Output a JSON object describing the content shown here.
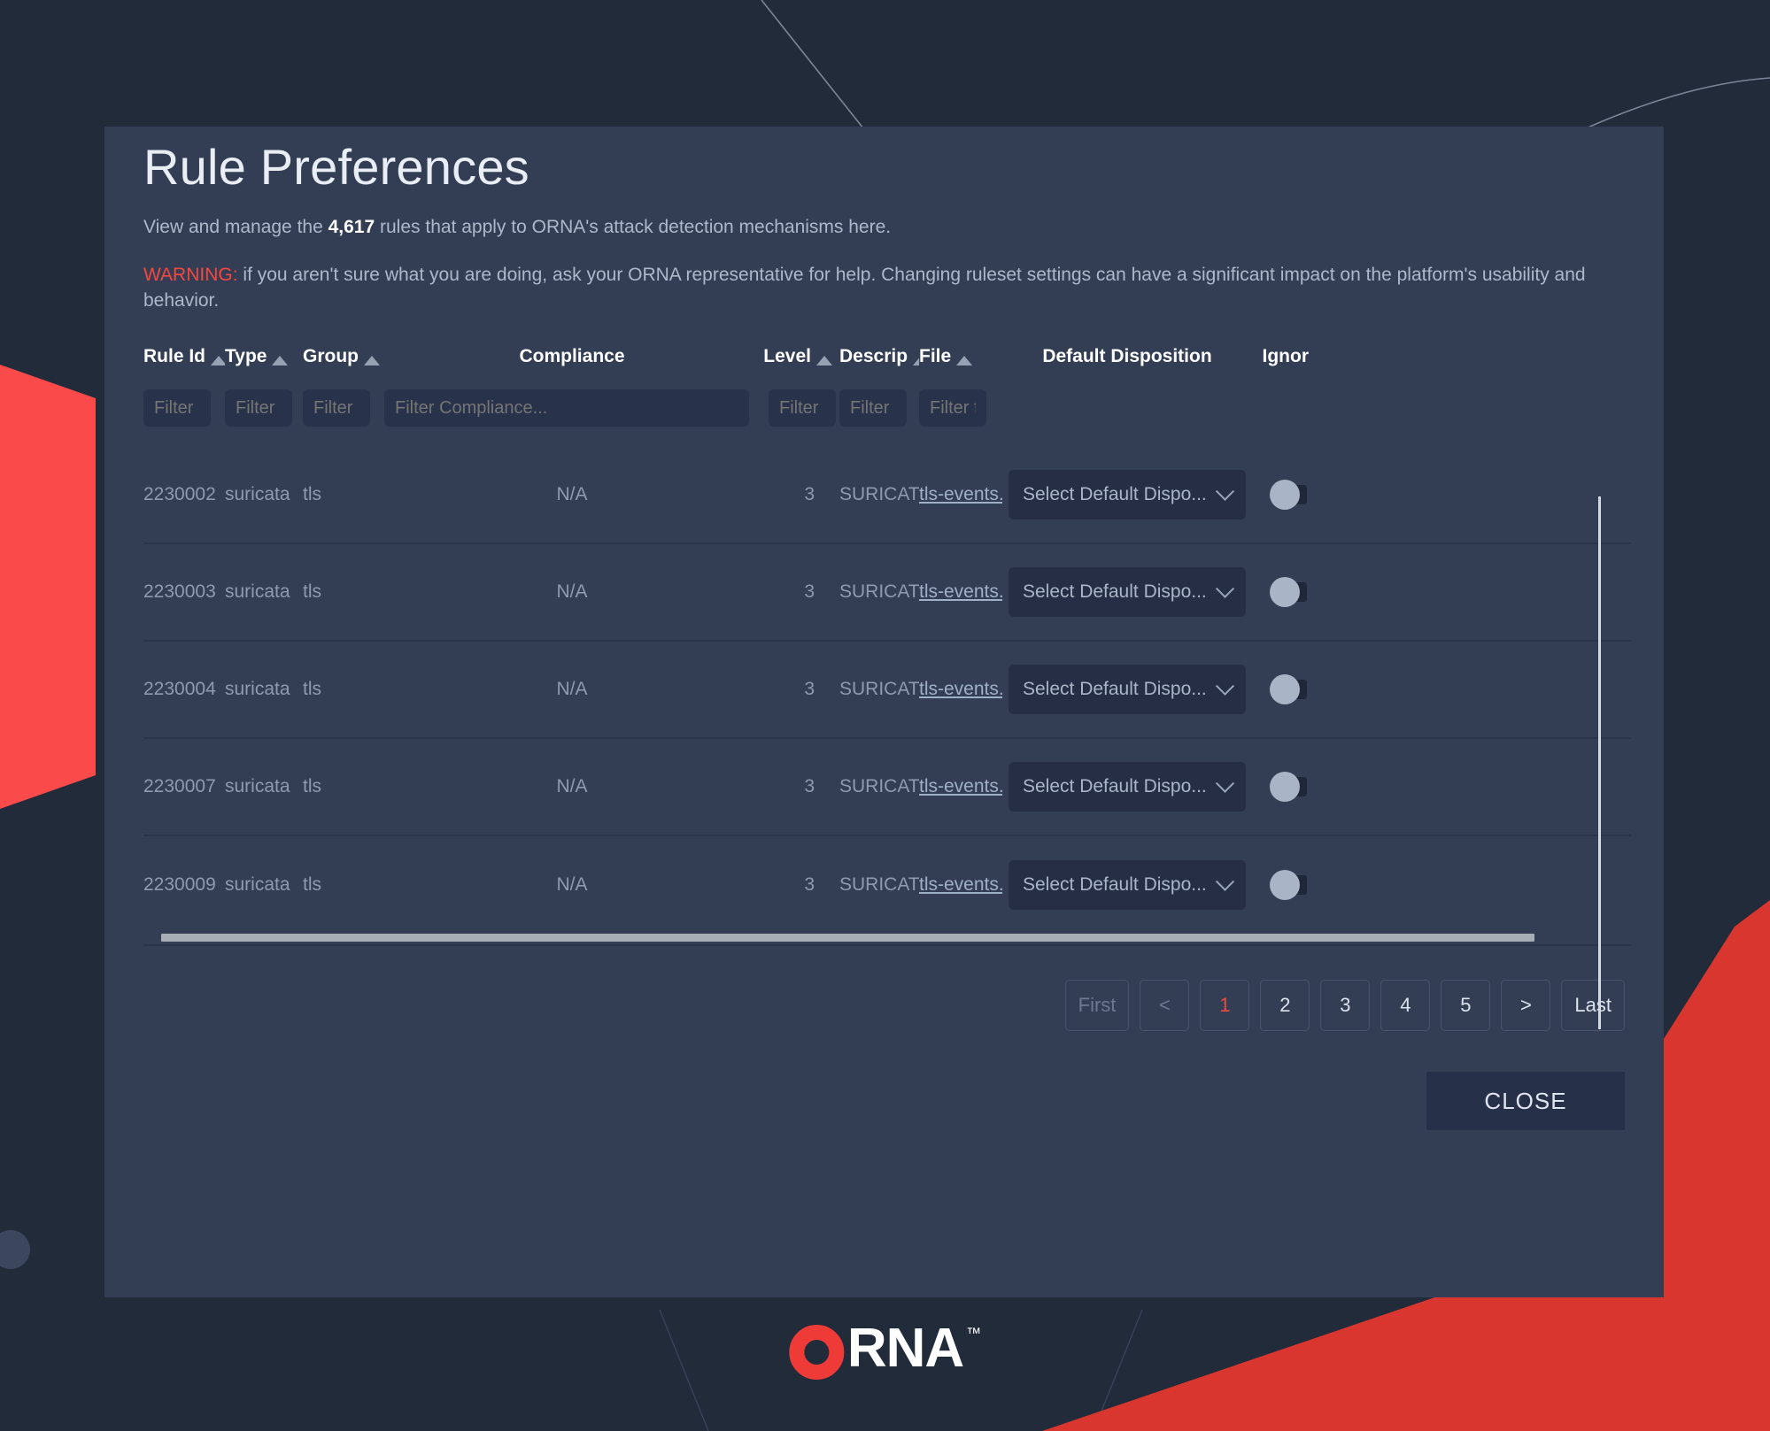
{
  "page": {
    "background_color": "#222b3a",
    "accent_red": "#f4483f"
  },
  "modal": {
    "title": "Rule Preferences",
    "subtitle_before": "View and manage the ",
    "subtitle_count": "4,617",
    "subtitle_after": " rules that apply to ORNA's attack detection mechanisms here.",
    "warning_label": "WARNING:",
    "warning_text": " if you aren't sure what you are doing, ask your ORNA representative for help. Changing ruleset settings can have a significant impact on the platform's usability and behavior.",
    "close_label": "CLOSE"
  },
  "table": {
    "columns": [
      {
        "key": "rule_id",
        "label": "Rule Id",
        "sortable": true
      },
      {
        "key": "type",
        "label": "Type",
        "sortable": true
      },
      {
        "key": "group",
        "label": "Group",
        "sortable": true
      },
      {
        "key": "compliance",
        "label": "Compliance",
        "sortable": false
      },
      {
        "key": "level",
        "label": "Level",
        "sortable": true
      },
      {
        "key": "description",
        "label": "Descrip",
        "sortable": true
      },
      {
        "key": "file",
        "label": "File",
        "sortable": true
      },
      {
        "key": "default_disposition",
        "label": "Default Disposition",
        "sortable": false
      },
      {
        "key": "ignore",
        "label": "Ignor",
        "sortable": false
      }
    ],
    "filters": {
      "rule_id": {
        "value": "",
        "placeholder": "Filter"
      },
      "type": {
        "value": "",
        "placeholder": "Filter"
      },
      "group": {
        "value": "",
        "placeholder": "Filter"
      },
      "compliance": {
        "value": "",
        "placeholder": "Filter Compliance..."
      },
      "level": {
        "value": "",
        "placeholder": "Filter"
      },
      "description": {
        "value": "",
        "placeholder": "Filter"
      },
      "file": {
        "value": "",
        "placeholder": "Filter f"
      }
    },
    "disposition_placeholder": "Select Default Dispo...",
    "rows": [
      {
        "rule_id": "2230002",
        "type": "suricata",
        "group": "tls",
        "compliance": "N/A",
        "level": "3",
        "description": "SURICAT.",
        "file": "tls-events.",
        "default_disposition": "Select Default Dispo...",
        "ignore": false
      },
      {
        "rule_id": "2230003",
        "type": "suricata",
        "group": "tls",
        "compliance": "N/A",
        "level": "3",
        "description": "SURICAT.",
        "file": "tls-events.",
        "default_disposition": "Select Default Dispo...",
        "ignore": false
      },
      {
        "rule_id": "2230004",
        "type": "suricata",
        "group": "tls",
        "compliance": "N/A",
        "level": "3",
        "description": "SURICAT.",
        "file": "tls-events.",
        "default_disposition": "Select Default Dispo...",
        "ignore": false
      },
      {
        "rule_id": "2230007",
        "type": "suricata",
        "group": "tls",
        "compliance": "N/A",
        "level": "3",
        "description": "SURICAT.",
        "file": "tls-events.",
        "default_disposition": "Select Default Dispo...",
        "ignore": false
      },
      {
        "rule_id": "2230009",
        "type": "suricata",
        "group": "tls",
        "compliance": "N/A",
        "level": "3",
        "description": "SURICAT.",
        "file": "tls-events.",
        "default_disposition": "Select Default Dispo...",
        "ignore": false
      }
    ]
  },
  "pagination": {
    "first_label": "First",
    "prev_label": "<",
    "next_label": ">",
    "last_label": "Last",
    "pages": [
      "1",
      "2",
      "3",
      "4",
      "5"
    ],
    "active_page": "1"
  },
  "logo": {
    "ring_letter": "O",
    "text": "RNA",
    "trademark": "™",
    "ring_color": "#ef3b38"
  }
}
